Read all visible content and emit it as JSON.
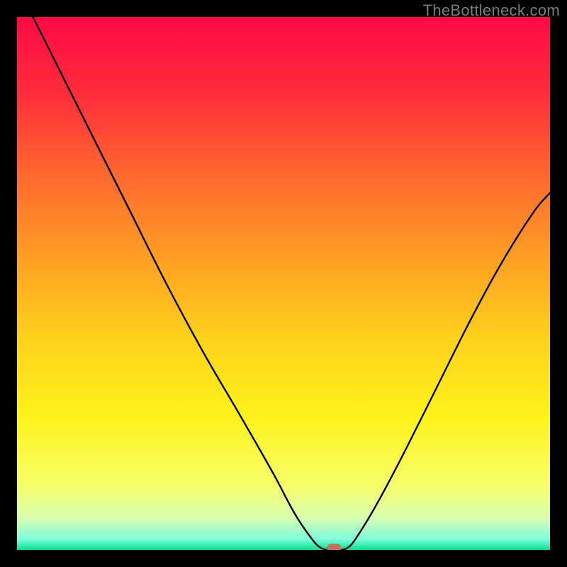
{
  "watermark": "TheBottleneck.com",
  "chart_data": {
    "type": "line",
    "title": "",
    "xlabel": "",
    "ylabel": "",
    "xlim": [
      0,
      100
    ],
    "ylim": [
      0,
      100
    ],
    "grid": false,
    "legend": false,
    "annotations": [],
    "background_gradient": {
      "stops": [
        {
          "y": 100,
          "color": "#ff0a45"
        },
        {
          "y": 85,
          "color": "#ff2f3b"
        },
        {
          "y": 70,
          "color": "#ff6a2e"
        },
        {
          "y": 55,
          "color": "#ff9e24"
        },
        {
          "y": 40,
          "color": "#ffd11c"
        },
        {
          "y": 25,
          "color": "#fff31a"
        },
        {
          "y": 12,
          "color": "#f6ff6b"
        },
        {
          "y": 6,
          "color": "#d7ffb0"
        },
        {
          "y": 2,
          "color": "#7cfedc"
        },
        {
          "y": 0,
          "color": "#00e28a"
        }
      ]
    },
    "series": [
      {
        "name": "bottleneck-curve",
        "points": [
          {
            "x": 3.0,
            "y": 100.0
          },
          {
            "x": 8.0,
            "y": 90.0
          },
          {
            "x": 14.0,
            "y": 78.0
          },
          {
            "x": 21.0,
            "y": 64.0
          },
          {
            "x": 28.0,
            "y": 50.0
          },
          {
            "x": 35.0,
            "y": 37.0
          },
          {
            "x": 42.0,
            "y": 25.0
          },
          {
            "x": 48.0,
            "y": 14.5
          },
          {
            "x": 52.0,
            "y": 7.0
          },
          {
            "x": 55.0,
            "y": 2.5
          },
          {
            "x": 57.0,
            "y": 0.4
          },
          {
            "x": 59.5,
            "y": 0.0
          },
          {
            "x": 62.0,
            "y": 0.4
          },
          {
            "x": 64.0,
            "y": 2.8
          },
          {
            "x": 68.0,
            "y": 9.5
          },
          {
            "x": 73.0,
            "y": 19.0
          },
          {
            "x": 79.0,
            "y": 31.0
          },
          {
            "x": 85.0,
            "y": 43.0
          },
          {
            "x": 91.0,
            "y": 54.0
          },
          {
            "x": 97.0,
            "y": 63.5
          },
          {
            "x": 100.0,
            "y": 67.0
          }
        ]
      }
    ],
    "marker": {
      "name": "optimal-point",
      "x": 59.5,
      "y": 0.3,
      "color": "#cc6a5c"
    }
  }
}
